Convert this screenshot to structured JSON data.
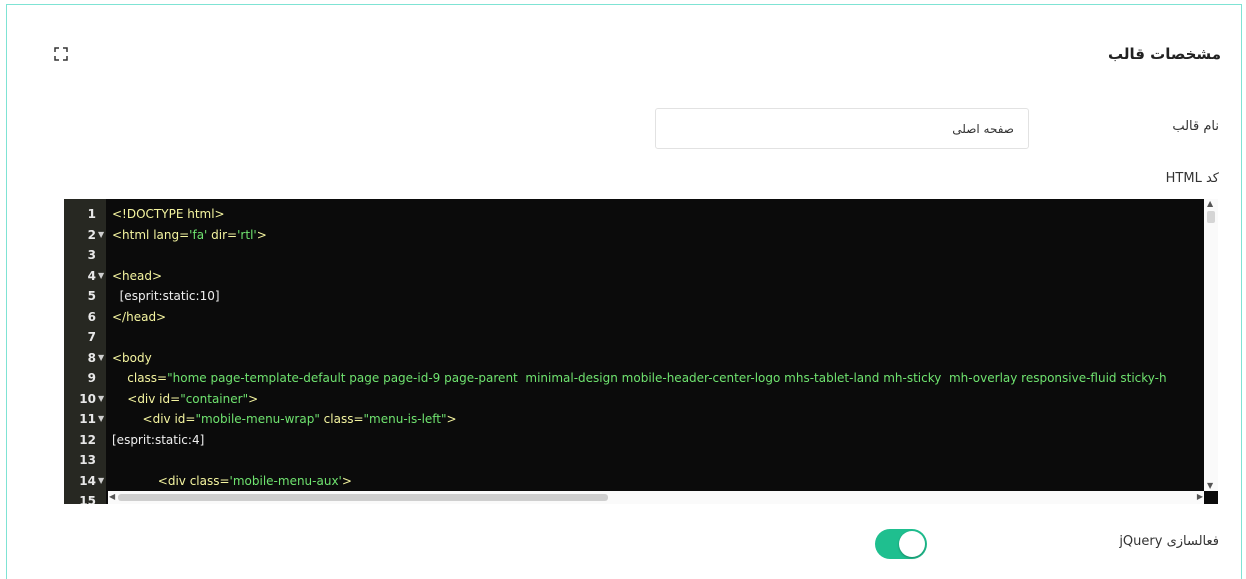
{
  "panel": {
    "title": "مشخصات قالب"
  },
  "form": {
    "name_label": "نام قالب",
    "name_value": "صفحه اصلی",
    "html_label": "کد HTML",
    "jquery_label": "فعالسازی jQuery",
    "jquery_enabled": true
  },
  "editor": {
    "lines": [
      {
        "n": "1",
        "fold": false,
        "parts": [
          [
            "tag",
            "<!DOCTYPE html>"
          ]
        ]
      },
      {
        "n": "2",
        "fold": true,
        "parts": [
          [
            "tag",
            "<html lang="
          ],
          [
            "str",
            "'fa'"
          ],
          [
            "attr",
            " dir="
          ],
          [
            "str",
            "'rtl'"
          ],
          [
            "tag",
            ">"
          ]
        ]
      },
      {
        "n": "3",
        "fold": false,
        "parts": []
      },
      {
        "n": "4",
        "fold": true,
        "parts": [
          [
            "tag",
            "<head>"
          ]
        ]
      },
      {
        "n": "5",
        "fold": false,
        "parts": [
          [
            "txt",
            "  [esprit:static:10]"
          ]
        ]
      },
      {
        "n": "6",
        "fold": false,
        "parts": [
          [
            "tag",
            "</head>"
          ]
        ]
      },
      {
        "n": "7",
        "fold": false,
        "parts": []
      },
      {
        "n": "8",
        "fold": true,
        "parts": [
          [
            "tag",
            "<body"
          ]
        ]
      },
      {
        "n": "9",
        "fold": false,
        "parts": [
          [
            "attr",
            "    class="
          ],
          [
            "str",
            "\"home page-template-default page page-id-9 page-parent  minimal-design mobile-header-center-logo mhs-tablet-land mh-sticky  mh-overlay responsive-fluid sticky-h"
          ]
        ]
      },
      {
        "n": "10",
        "fold": true,
        "parts": [
          [
            "tag",
            "    <div id="
          ],
          [
            "str",
            "\"container\""
          ],
          [
            "tag",
            ">"
          ]
        ]
      },
      {
        "n": "11",
        "fold": true,
        "parts": [
          [
            "tag",
            "        <div id="
          ],
          [
            "str",
            "\"mobile-menu-wrap\""
          ],
          [
            "attr",
            " class="
          ],
          [
            "str",
            "\"menu-is-left\""
          ],
          [
            "tag",
            ">"
          ]
        ]
      },
      {
        "n": "12",
        "fold": false,
        "parts": [
          [
            "txt",
            "[esprit:static:4]"
          ]
        ]
      },
      {
        "n": "13",
        "fold": false,
        "parts": []
      },
      {
        "n": "14",
        "fold": true,
        "parts": [
          [
            "tag",
            "            <div class="
          ],
          [
            "str",
            "'mobile-menu-aux'"
          ],
          [
            "tag",
            ">"
          ]
        ]
      },
      {
        "n": "15",
        "fold": false,
        "parts": []
      }
    ]
  },
  "icons": {
    "expand": "expand-icon",
    "fold": "fold-arrow-icon"
  },
  "colors": {
    "accent": "#1fbf8f",
    "frame_border": "#7fe3d4",
    "editor_bg": "#0b0b0b",
    "tag": "#f5f5a0",
    "string": "#6fe36f"
  }
}
